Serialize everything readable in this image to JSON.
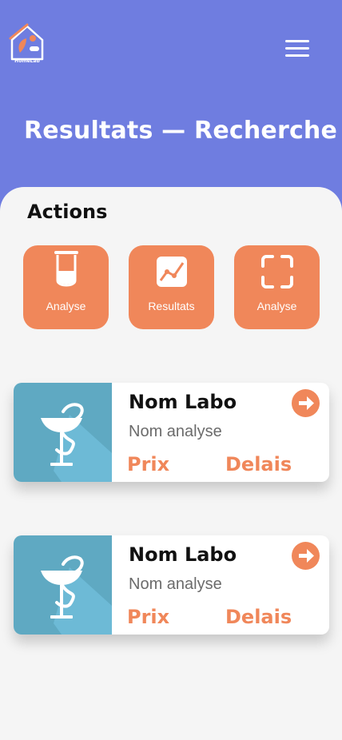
{
  "colors": {
    "header": "#6f7de0",
    "accent": "#f0875a",
    "panel": "#f5f5f5",
    "thumb": "#5fa9c2"
  },
  "app": {
    "logo_text": "HomeLab",
    "menu_icon": "hamburger-icon"
  },
  "header": {
    "title": "Resultats — Recherche"
  },
  "actions": {
    "title": "Actions",
    "items": [
      {
        "label": "Analyse",
        "icon": "test-tube-icon"
      },
      {
        "label": "Resultats",
        "icon": "chart-icon"
      },
      {
        "label": "Analyse",
        "icon": "scan-icon"
      }
    ]
  },
  "results": [
    {
      "lab": "Nom Labo",
      "analysis": "Nom analyse",
      "price": "Prix",
      "delay": "Delais",
      "icon": "pharmacy-icon"
    },
    {
      "lab": "Nom Labo",
      "analysis": "Nom analyse",
      "price": "Prix",
      "delay": "Delais",
      "icon": "pharmacy-icon"
    }
  ]
}
